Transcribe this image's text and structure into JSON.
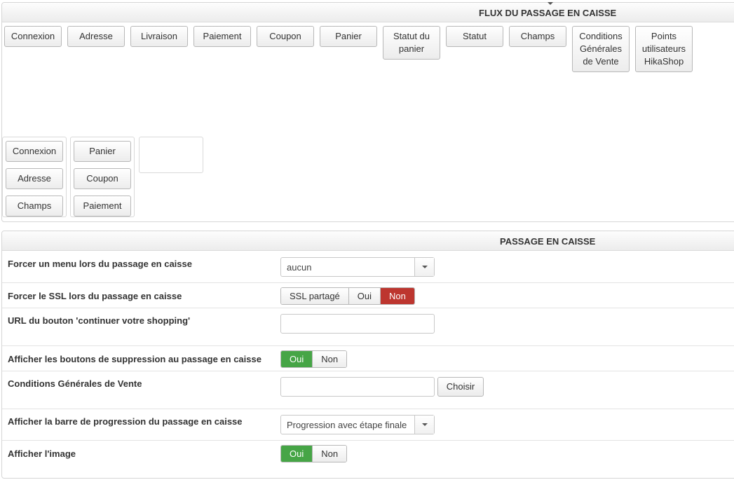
{
  "flow": {
    "title": "FLUX DU PASSAGE EN CAISSE",
    "steps": [
      {
        "label": "Connexion"
      },
      {
        "label": "Adresse"
      },
      {
        "label": "Livraison"
      },
      {
        "label": "Paiement"
      },
      {
        "label": "Coupon"
      },
      {
        "label": "Panier"
      },
      {
        "label": "Statut du panier"
      },
      {
        "label": "Statut"
      },
      {
        "label": "Champs"
      },
      {
        "label": "Conditions Générales de Vente"
      },
      {
        "label": "Points utilisateurs HikaShop"
      }
    ],
    "groups": [
      {
        "items": [
          "Connexion",
          "Adresse",
          "Champs"
        ]
      },
      {
        "items": [
          "Panier",
          "Coupon",
          "Paiement"
        ]
      },
      {
        "items": []
      }
    ]
  },
  "checkout": {
    "title": "PASSAGE EN CAISSE",
    "rows": [
      {
        "label": "Forcer un menu lors du passage en caisse",
        "type": "select",
        "value": "aucun"
      },
      {
        "label": "Forcer le SSL lors du passage en caisse",
        "type": "toggle",
        "options": [
          "SSL partagé",
          "Oui",
          "Non"
        ],
        "selected": "Non"
      },
      {
        "label": "URL du bouton 'continuer votre shopping'",
        "type": "text",
        "value": ""
      },
      {
        "label": "Afficher les boutons de suppression au passage en caisse",
        "type": "toggle",
        "options": [
          "Oui",
          "Non"
        ],
        "selected": "Oui"
      },
      {
        "label": "Conditions Générales de Vente",
        "type": "text-button",
        "value": "",
        "button_label": "Choisir"
      },
      {
        "label": "Afficher la barre de progression du passage en caisse",
        "type": "select",
        "value": "Progression avec étape finale"
      },
      {
        "label": "Afficher l'image",
        "type": "toggle",
        "options": [
          "Oui",
          "Non"
        ],
        "selected": "Oui"
      }
    ]
  },
  "colors": {
    "active_red": "#bd362f",
    "active_green": "#46a546"
  }
}
